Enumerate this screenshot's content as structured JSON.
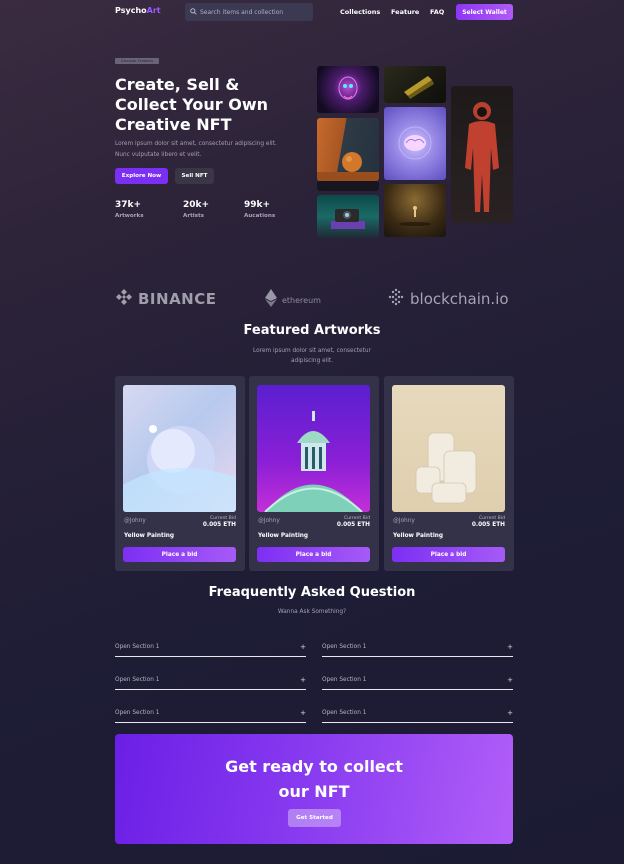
{
  "nav": {
    "logo_main": "Psycho",
    "logo_accent": "Art",
    "search_placeholder": "Search items and collection",
    "links": [
      "Collections",
      "Feature",
      "FAQ"
    ],
    "wallet_button": "Select Wallet"
  },
  "hero": {
    "tag": "Discover Creators",
    "title_lines": [
      "Create, Sell &",
      "Collect Your Own",
      "Creative NFT"
    ],
    "description": "Lorem ipsum dolor sit amet, consectetur adipiscing elit. Nunc vulputate libero et velit.",
    "explore_button": "Explore Now",
    "sell_button": "Sell NFT",
    "stats": [
      {
        "value": "37k+",
        "label": "Artworks"
      },
      {
        "value": "20k+",
        "label": "Artists"
      },
      {
        "value": "99k+",
        "label": "Aucations"
      }
    ]
  },
  "partners": [
    "BINANCE",
    "ethereum",
    "blockchain.io"
  ],
  "featured": {
    "title": "Featured Artworks",
    "subtitle_lines": [
      "Lorem ipsum dolor sit amet, consectetur",
      "adipiscing elit."
    ],
    "cards": [
      {
        "owner": "@Johny",
        "bid_label": "Current Bid",
        "bid_value": "0.005 ETH",
        "name": "Yellow Painting",
        "button": "Place a bid"
      },
      {
        "owner": "@Johny",
        "bid_label": "Current Bid",
        "bid_value": "0.005 ETH",
        "name": "Yellow Painting",
        "button": "Place a bid"
      },
      {
        "owner": "@Johny",
        "bid_label": "Current Bid",
        "bid_value": "0.005 ETH",
        "name": "Yellow Painting",
        "button": "Place a bid"
      }
    ]
  },
  "faq": {
    "title": "Freaquently Asked Question",
    "subtitle": "Wanna Ask Something?",
    "items": [
      "Open Section 1",
      "Open Section 1",
      "Open Section 1",
      "Open Section 1",
      "Open Section 1",
      "Open Section 1"
    ],
    "expand_symbol": "+"
  },
  "cta": {
    "title_lines": [
      "Get ready to collect",
      "our NFT"
    ],
    "button": "Get Started"
  },
  "colors": {
    "accent": "#7b2ff3",
    "accent_light": "#b05af7",
    "card_bg": "#343248"
  }
}
